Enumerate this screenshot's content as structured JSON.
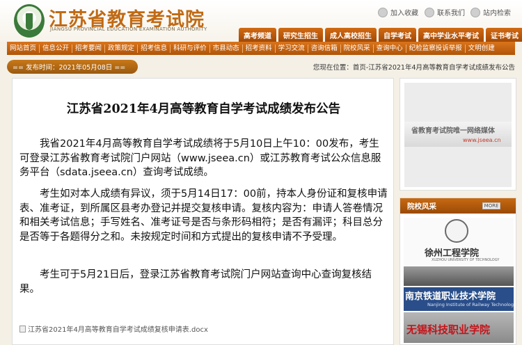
{
  "header": {
    "site_title": "江苏省教育考试院",
    "site_subtitle": "JIANGSU PROVINCIAL EDUCATION EXAMINATION AUTHORITY",
    "utils": [
      "加入收藏",
      "联系我们",
      "站内检索"
    ]
  },
  "top_tabs": [
    "高考频道",
    "研究生招生",
    "成人高校招生",
    "自学考试",
    "高中学业水平考试",
    "证书考试"
  ],
  "nav": [
    "网站首页",
    "信息公开",
    "招考要闻",
    "政策规定",
    "招考信息",
    "科研与评价",
    "市县动态",
    "招考资料",
    "学习交流",
    "咨询信箱",
    "院校风采",
    "查询中心",
    "纪检监察投诉举报",
    "文明创建"
  ],
  "datebar": {
    "date_text": "== 发布时间：2021年05月08日 ==",
    "breadcrumb": "您现在位置：首页-江苏省2021年4月高等教育自学考试成绩发布公告"
  },
  "article": {
    "title": "江苏省2021年4月高等教育自学考试成绩发布公告",
    "paragraphs": [
      "我省2021年4月高等教育自学考试成绩将于5月10日上午10：00发布，考生可登录江苏省教育考试院门户网站（www.jseea.cn）或江苏教育考试公众信息服务平台（sdata.jseea.cn）查询考试成绩。",
      "考生如对本人成绩有异议，须于5月14日17：00前，持本人身份证和复核申请表、准考证，到所属区县考办登记并提交复核申请。复核内容为：申请人答卷情况和相关考试信息；手写姓名、准考证号是否与条形码相符；是否有漏评；科目总分是否等于各题得分之和。未按规定时间和方式提出的复核申请不予受理。",
      "考生可于5月21日后，登录江苏省教育考试院门户网站查询中心查询复核结果。"
    ],
    "attachment": "江苏省2021年4月高等教育自学考试成绩复核申请表.docx"
  },
  "sidebar": {
    "ad_text": "省教育考试院唯一网络媒体",
    "ad_url": "www.jseea.cn",
    "school_section_label": "院校风采",
    "more_label": "MORE",
    "schools": [
      {
        "name": "徐州工程学院",
        "sub": "XUZHOU UNIVERSITY OF TECHNOLOGY"
      },
      {
        "name": "南京铁道职业技术学院",
        "sub": "Nanjing Institute of Railway Technology"
      },
      {
        "name": "无锡科技职业学院"
      }
    ]
  },
  "colors": {
    "brand_orange": "#c06a14",
    "nav_orange": "#b05508",
    "page_bg": "#f4f0e6"
  }
}
